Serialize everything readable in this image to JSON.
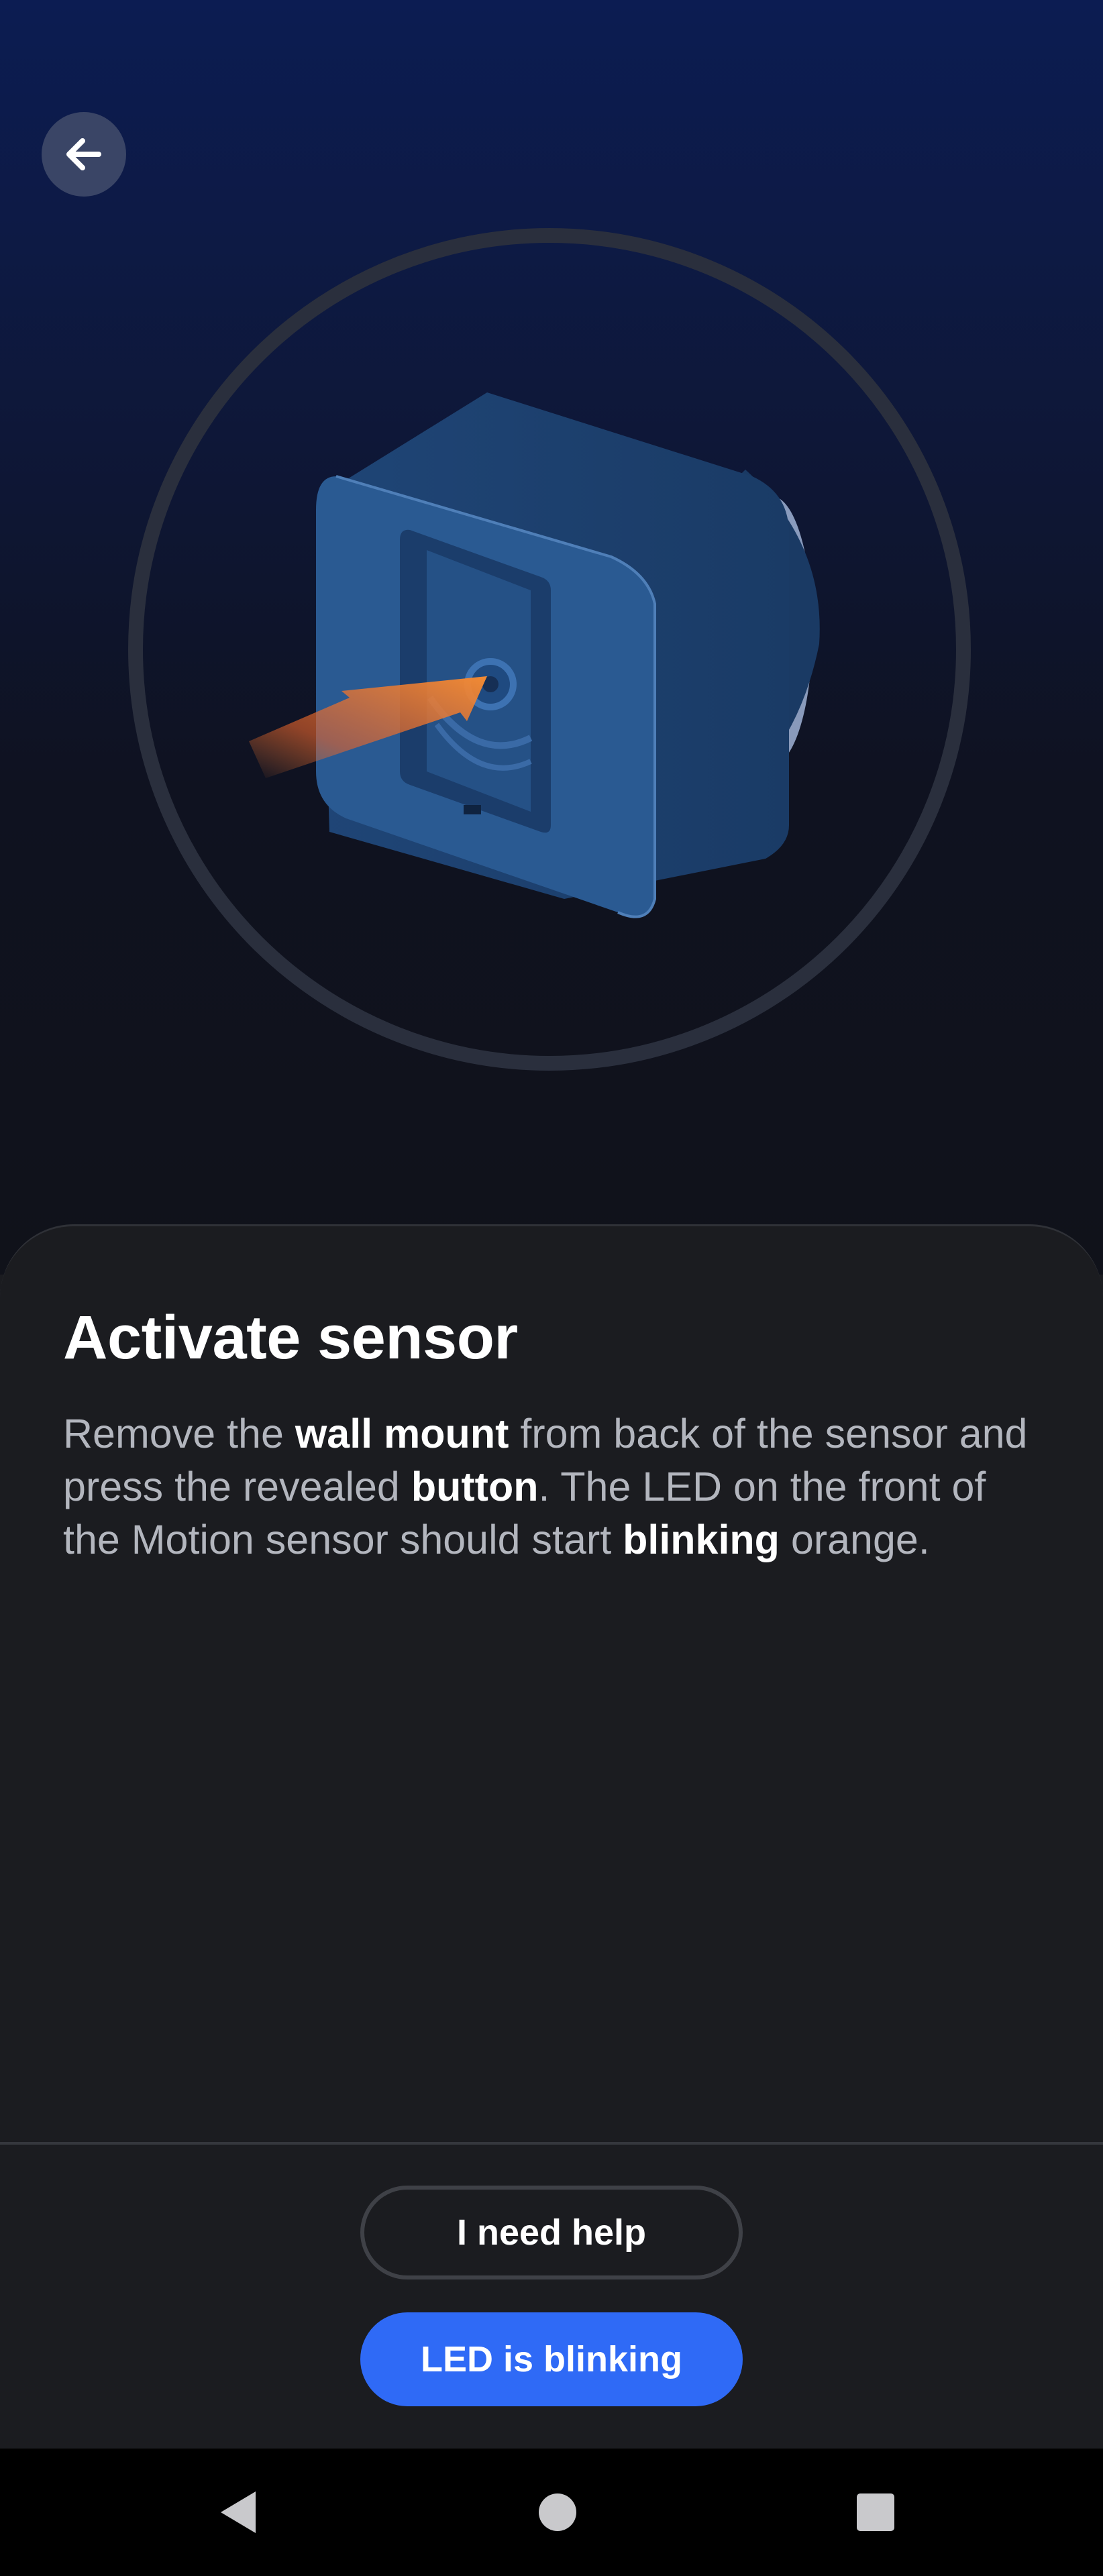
{
  "header": {
    "back_icon": "arrow-left-icon"
  },
  "illustration": {
    "subject": "sensor-button-illustration",
    "accent_color": "#f07a2e"
  },
  "sheet": {
    "title": "Activate sensor",
    "description": {
      "p1": "Remove the ",
      "b1": "wall mount",
      "p2": " from back of the sensor and press the revealed ",
      "b2": "button",
      "p3": ". The LED on the front of the Motion sensor should start ",
      "b3": "blinking",
      "p4": " orange."
    }
  },
  "actions": {
    "help_label": "I need help",
    "primary_label": "LED is blinking",
    "primary_color": "#2f6af6"
  },
  "system_nav": {
    "back_icon": "triangle-back-icon",
    "home_icon": "circle-home-icon",
    "recent_icon": "square-recents-icon"
  }
}
